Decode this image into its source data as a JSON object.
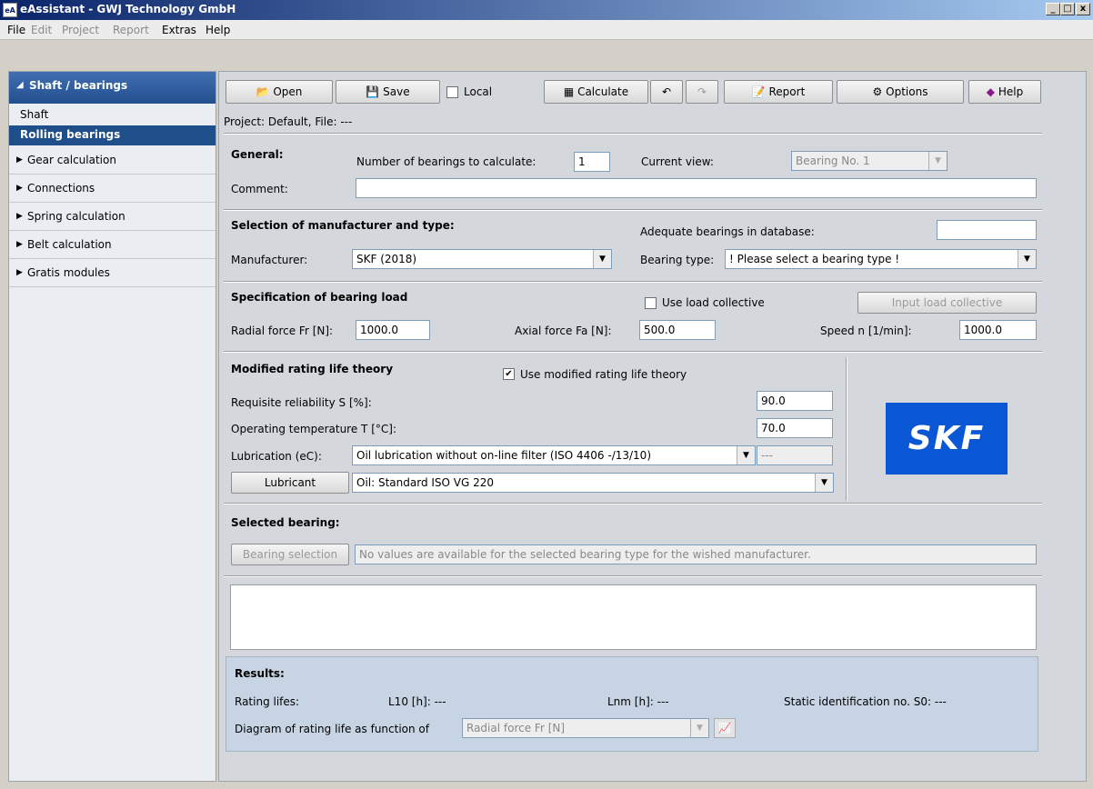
{
  "window": {
    "icon": "eA",
    "title": "eAssistant - GWJ Technology GmbH",
    "minimize": "_",
    "maximize": "□",
    "close": "x"
  },
  "menu": [
    {
      "label": "File",
      "enabled": true
    },
    {
      "label": "Edit",
      "enabled": false
    },
    {
      "label": "Project",
      "enabled": false
    },
    {
      "label": "Report",
      "enabled": false
    },
    {
      "label": "Extras",
      "enabled": true
    },
    {
      "label": "Help",
      "enabled": true
    }
  ],
  "sidebar": {
    "section": "Shaft / bearings",
    "items": [
      "Shaft",
      "Rolling bearings"
    ],
    "groups": [
      "Gear calculation",
      "Connections",
      "Spring calculation",
      "Belt calculation",
      "Gratis modules"
    ]
  },
  "toolbar": {
    "open": "Open",
    "save": "Save",
    "local": "Local",
    "calculate": "Calculate",
    "report": "Report",
    "options": "Options",
    "help": "Help"
  },
  "project_info": "Project: Default, File: ---",
  "general": {
    "title": "General:",
    "num_label": "Number of bearings to calculate:",
    "num_value": "1",
    "view_label": "Current view:",
    "view_value": "Bearing No. 1",
    "comment_label": "Comment:",
    "comment_value": ""
  },
  "selection": {
    "title": "Selection of manufacturer and type:",
    "adequate_label": "Adequate bearings in database:",
    "adequate_value": "",
    "manufacturer_label": "Manufacturer:",
    "manufacturer_value": "SKF (2018)",
    "type_label": "Bearing type:",
    "type_value": "! Please select a bearing type !"
  },
  "load": {
    "title": "Specification of bearing load",
    "collective_label": "Use load collective",
    "collective_button": "Input load collective",
    "radial_label": "Radial force Fr [N]:",
    "radial_value": "1000.0",
    "axial_label": "Axial force Fa [N]:",
    "axial_value": "500.0",
    "speed_label": "Speed n [1/min]:",
    "speed_value": "1000.0"
  },
  "rating": {
    "title": "Modified rating life theory",
    "use_label": "Use modified rating life theory",
    "reliability_label": "Requisite reliability S [%]:",
    "reliability_value": "90.0",
    "temp_label": "Operating temperature T [°C]:",
    "temp_value": "70.0",
    "lub_label": "Lubrication (eC):",
    "lub_value": "Oil lubrication without on-line filter (ISO 4406 -/13/10)",
    "lub_extra": "---",
    "lubricant_button": "Lubricant",
    "lubricant_value": "Oil:  Standard ISO VG 220",
    "logo": "SKF"
  },
  "selected": {
    "title": "Selected bearing:",
    "button": "Bearing selection",
    "message": "No values are available for the selected bearing type for the wished manufacturer."
  },
  "results": {
    "title": "Results:",
    "rating_label": "Rating lifes:",
    "l10": "L10 [h]: ---",
    "lnm": "Lnm [h]: ---",
    "static": "Static identification no. S0: ---",
    "diagram_label": "Diagram of rating life as function of",
    "diagram_value": "Radial force Fr [N]"
  }
}
